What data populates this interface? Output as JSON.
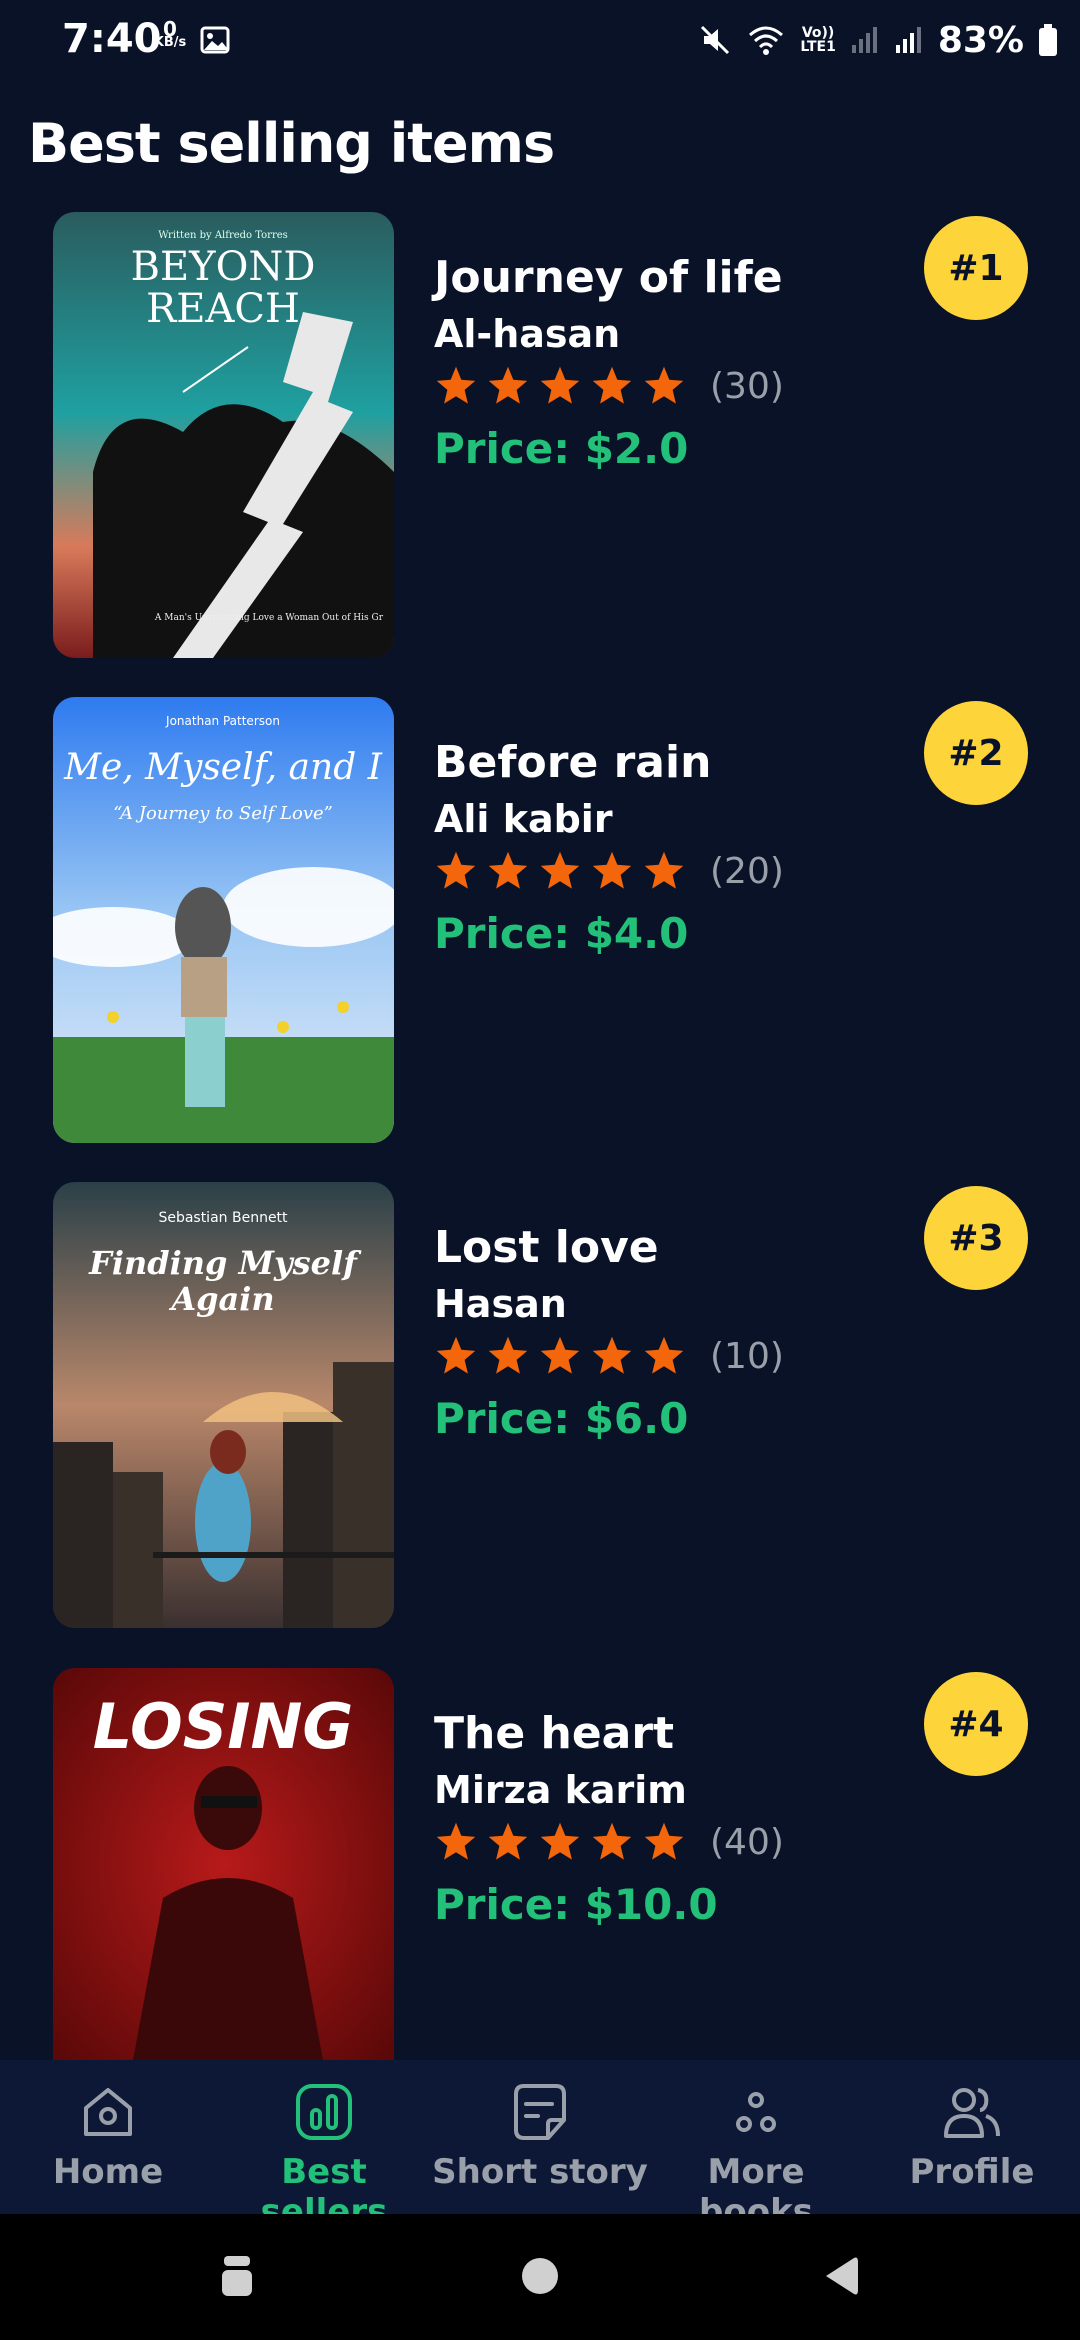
{
  "status_bar": {
    "time": "7:40",
    "net_speed_value": "0",
    "net_speed_unit": "KB/s",
    "network_label_top": "Vo))",
    "network_label_bottom": "LTE1",
    "battery": "83%"
  },
  "page": {
    "title": "Best selling items"
  },
  "books": [
    {
      "rank": "#1",
      "title": "Journey of life",
      "author": "Al-hasan",
      "stars": 5,
      "rating_count": "(30)",
      "price": "Price: $2.0",
      "cover_author": "Written by Alfredo Torres",
      "cover_title_1": "BEYOND",
      "cover_title_2": "REACH",
      "cover_tagline": "A Man's Unrelenting Love a Woman Out of His Gr"
    },
    {
      "rank": "#2",
      "title": "Before rain",
      "author": "Ali kabir",
      "stars": 5,
      "rating_count": "(20)",
      "price": "Price: $4.0",
      "cover_author": "Jonathan Patterson",
      "cover_title_1": "Me, Myself, and I",
      "cover_title_2": "“A Journey to Self Love”"
    },
    {
      "rank": "#3",
      "title": "Lost love",
      "author": "Hasan",
      "stars": 5,
      "rating_count": "(10)",
      "price": "Price: $6.0",
      "cover_author": "Sebastian Bennett",
      "cover_title_1": "Finding Myself",
      "cover_title_2": "Again"
    },
    {
      "rank": "#4",
      "title": "The heart",
      "author": "Mirza karim",
      "stars": 5,
      "rating_count": "(40)",
      "price": "Price: $10.0",
      "cover_title_1": "LOSING"
    }
  ],
  "bottom_nav": {
    "items": [
      {
        "label": "Home",
        "icon": "home-icon"
      },
      {
        "label": "Best sellers",
        "icon": "chart-icon",
        "active": true
      },
      {
        "label": "Short story",
        "icon": "note-icon"
      },
      {
        "label": "More books",
        "icon": "dots-icon"
      },
      {
        "label": "Profile",
        "icon": "people-icon"
      }
    ]
  },
  "colors": {
    "background": "#0a1228",
    "accent_green": "#23c07a",
    "star_orange": "#f4660b",
    "badge_yellow": "#fdd43a"
  }
}
